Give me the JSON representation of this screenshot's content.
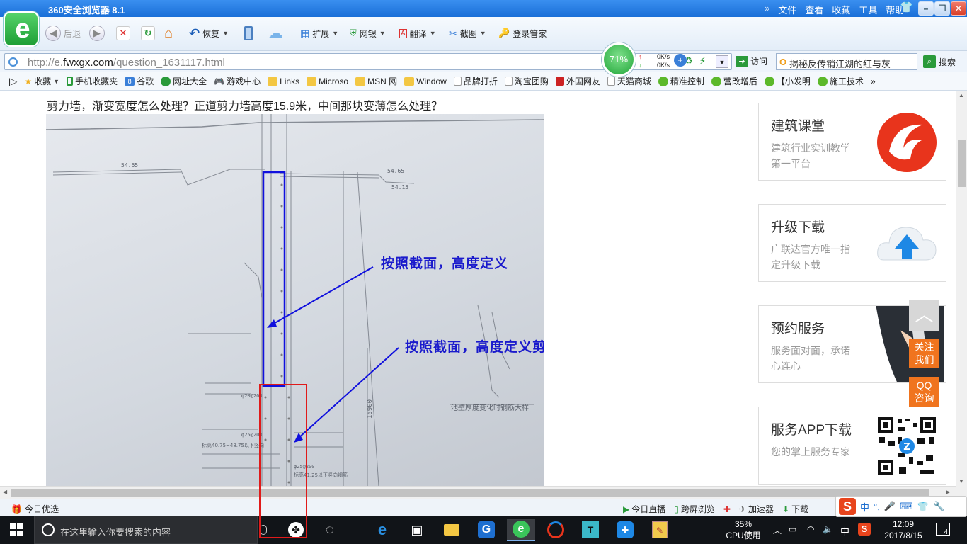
{
  "browser": {
    "title": "360安全浏览器 8.1",
    "menu": [
      "文件",
      "查看",
      "收藏",
      "工具",
      "帮助"
    ],
    "menu_chevron": "»",
    "logo_letter": "e",
    "toolbar": {
      "back": "后退",
      "restore": "恢复",
      "extend": "扩展",
      "netbank": "网银",
      "translate": "翻译",
      "screenshot": "截图",
      "login": "登录管家"
    },
    "address": {
      "url_prefix": "http://e.",
      "url_domain": "fwxgx.com",
      "url_path": "/question_1631117.html"
    },
    "speed": {
      "percent": "71%",
      "up": "0K/s",
      "down": "0K/s"
    },
    "visit_label": "访问",
    "search": {
      "value": "揭秘反传销江湖的红与灰",
      "button": "搜索"
    },
    "favorites": [
      "收藏",
      "手机收藏夹",
      "谷歌",
      "网址大全",
      "游戏中心",
      "Links",
      "Microso",
      "MSN 网",
      "Window",
      "品牌打折",
      "淘宝团购",
      "外国网友",
      "天猫商城",
      "精准控制",
      "营改增后",
      "【小发明",
      "施工技术"
    ],
    "favorites_more": "»"
  },
  "page": {
    "question_title": "剪力墙，渐变宽度怎么处理？正道剪力墙高度15.9米，中间那块变薄怎么处理？",
    "drawing": {
      "annotation_top": "按照截面，高度定义",
      "annotation_bottom": "按照截面，高度定义剪力墙",
      "elev_a": "54.65",
      "elev_b": "54.15",
      "elev_c": "54.65",
      "dim_vertical": "15900",
      "label_detail": "池壁厚度变化时钢筋大样",
      "rebar_a": "φ20@200",
      "rebar_b": "φ25@200",
      "rebar_c": "φ25@200",
      "note_a": "标高40.75~48.75以下竖向",
      "note_b": "标高41.25以下竖向钢筋"
    },
    "sidebar": [
      {
        "title": "建筑课堂",
        "subtitle": "建筑行业实训教学第一平台",
        "icon": "logo-icon"
      },
      {
        "title": "升级下载",
        "subtitle": "广联达官方唯一指定升级下载",
        "icon": "cloud-upload-icon"
      },
      {
        "title": "预约服务",
        "subtitle": "服务面对面，承诺心连心",
        "icon": "service-person-icon"
      },
      {
        "title": "服务APP下载",
        "subtitle": "您的掌上服务专家",
        "icon": "qr-code-icon"
      }
    ],
    "float": {
      "to_top": "︿",
      "follow": "关注我们",
      "follow_1": "关注",
      "follow_2": "我们",
      "qq_1": "QQ",
      "qq_2": "咨询"
    }
  },
  "statusbar": {
    "left": "今日优选",
    "live": "今日直播",
    "cross_screen": "跨屏浏览",
    "accelerator": "加速器",
    "download": "下载"
  },
  "ime": {
    "lang": "中",
    "punct": "°,"
  },
  "taskbar": {
    "search_placeholder": "在这里输入你要搜索的内容",
    "cpu_percent": "35%",
    "cpu_label": "CPU使用",
    "tray_lang": "中",
    "time": "12:09",
    "date": "2017/8/15",
    "notifications": "4"
  },
  "colors": {
    "titlebar": "#1a6fd8",
    "annotation_blue": "#1a1acc",
    "highlight_red": "#e01a1a",
    "float_orange": "#f0741e"
  }
}
